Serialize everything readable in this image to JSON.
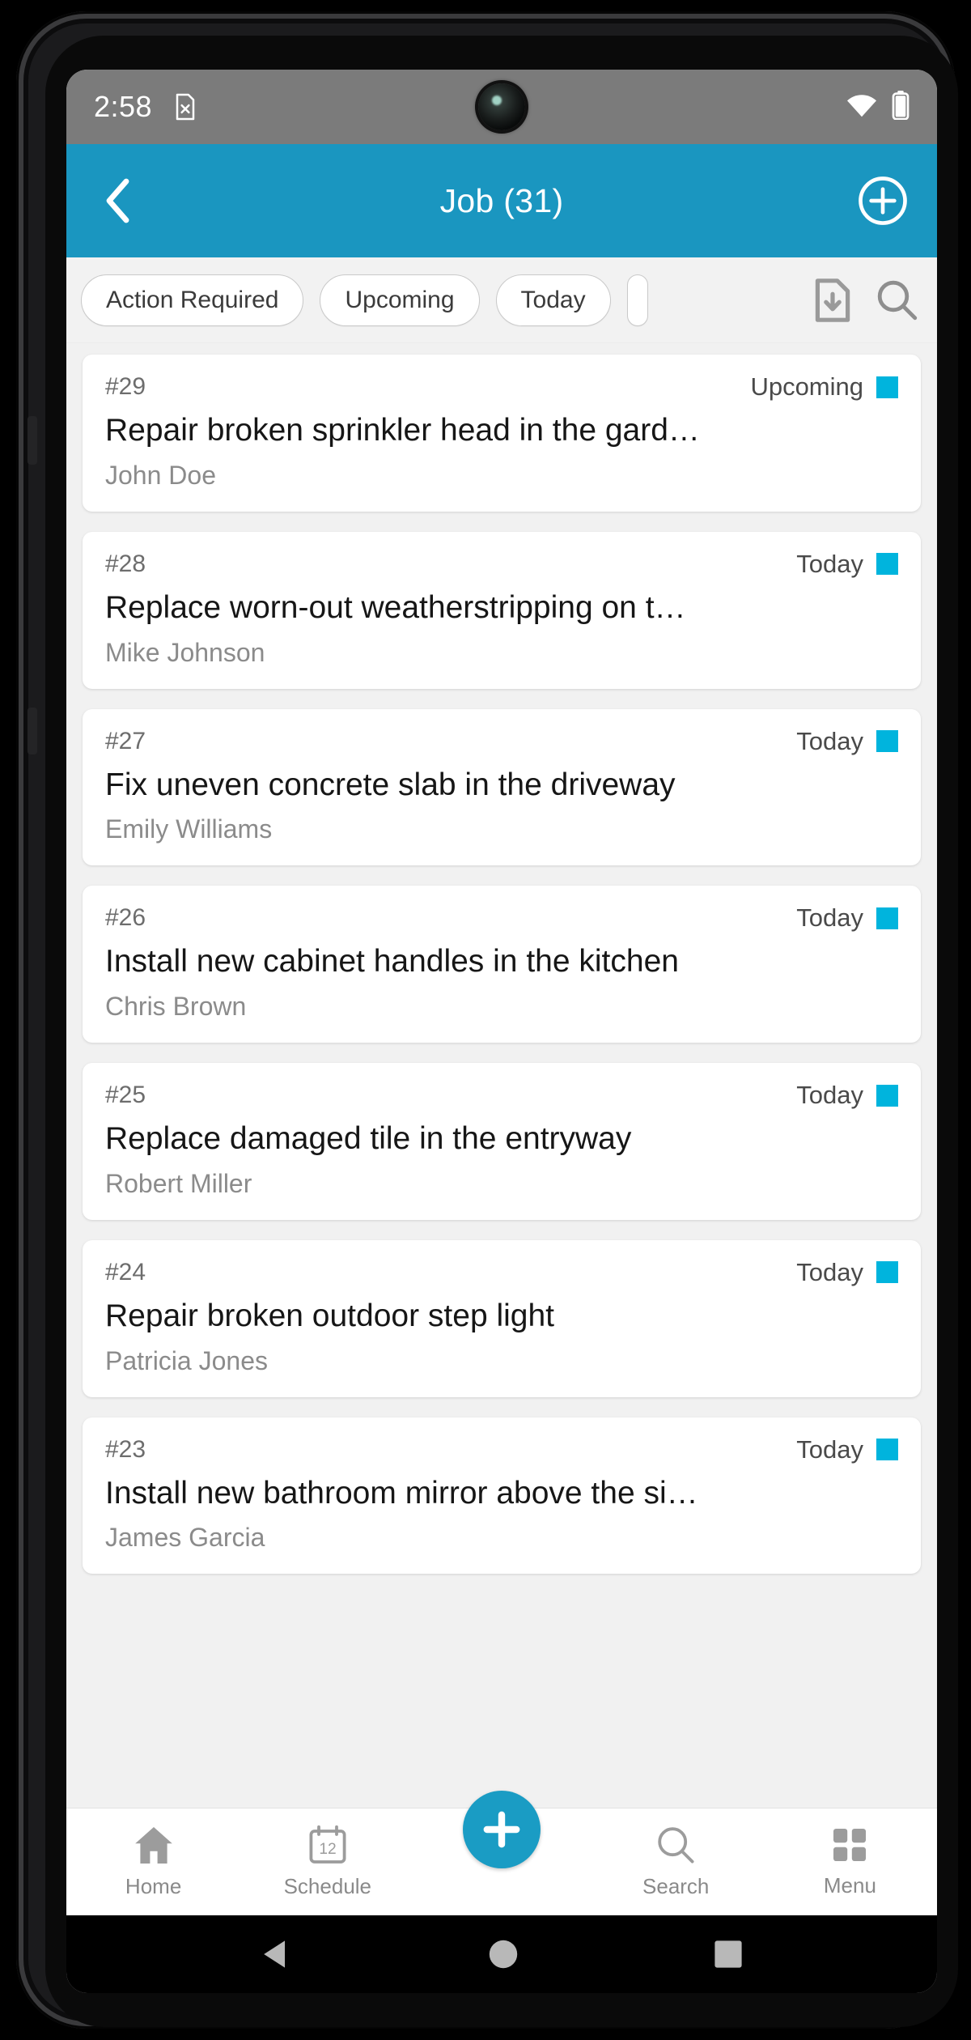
{
  "status_bar": {
    "time": "2:58",
    "sim_icon": "sim-card-off-icon",
    "wifi_icon": "wifi-icon",
    "battery_icon": "battery-icon"
  },
  "header": {
    "back_icon": "chevron-left-icon",
    "title": "Job (31)",
    "add_icon": "plus-circle-icon",
    "background_color": "#1a96c0"
  },
  "filter_bar": {
    "chips": [
      {
        "label": "Action Required"
      },
      {
        "label": "Upcoming"
      },
      {
        "label": "Today"
      },
      {
        "label": ""
      }
    ],
    "actions": [
      {
        "icon": "file-download-icon",
        "name": "export-button"
      },
      {
        "icon": "search-icon",
        "name": "search-button"
      }
    ]
  },
  "jobs": [
    {
      "id": "#29",
      "status": "Upcoming",
      "status_color": "#00b4dd",
      "title": "Repair broken sprinkler head in the gard…",
      "person": "John Doe"
    },
    {
      "id": "#28",
      "status": "Today",
      "status_color": "#00b4dd",
      "title": "Replace worn-out weatherstripping on t…",
      "person": "Mike Johnson"
    },
    {
      "id": "#27",
      "status": "Today",
      "status_color": "#00b4dd",
      "title": "Fix uneven concrete slab in the driveway",
      "person": "Emily Williams"
    },
    {
      "id": "#26",
      "status": "Today",
      "status_color": "#00b4dd",
      "title": "Install new cabinet handles in the kitchen",
      "person": "Chris Brown"
    },
    {
      "id": "#25",
      "status": "Today",
      "status_color": "#00b4dd",
      "title": "Replace damaged tile in the entryway",
      "person": "Robert Miller"
    },
    {
      "id": "#24",
      "status": "Today",
      "status_color": "#00b4dd",
      "title": "Repair broken outdoor step light",
      "person": "Patricia Jones"
    },
    {
      "id": "#23",
      "status": "Today",
      "status_color": "#00b4dd",
      "title": "Install new bathroom mirror above the si…",
      "person": "James Garcia"
    }
  ],
  "bottom_nav": {
    "items": [
      {
        "label": "Home",
        "icon": "home-icon"
      },
      {
        "label": "Schedule",
        "icon": "calendar-icon",
        "calendar_day": "12"
      },
      {
        "label": "Search",
        "icon": "search-icon"
      },
      {
        "label": "Menu",
        "icon": "grid-menu-icon"
      }
    ],
    "fab": {
      "icon": "plus-icon",
      "color": "#1a9cc4"
    }
  },
  "system_nav": {
    "back": "triangle-back-icon",
    "home": "circle-home-icon",
    "recents": "square-recents-icon"
  }
}
